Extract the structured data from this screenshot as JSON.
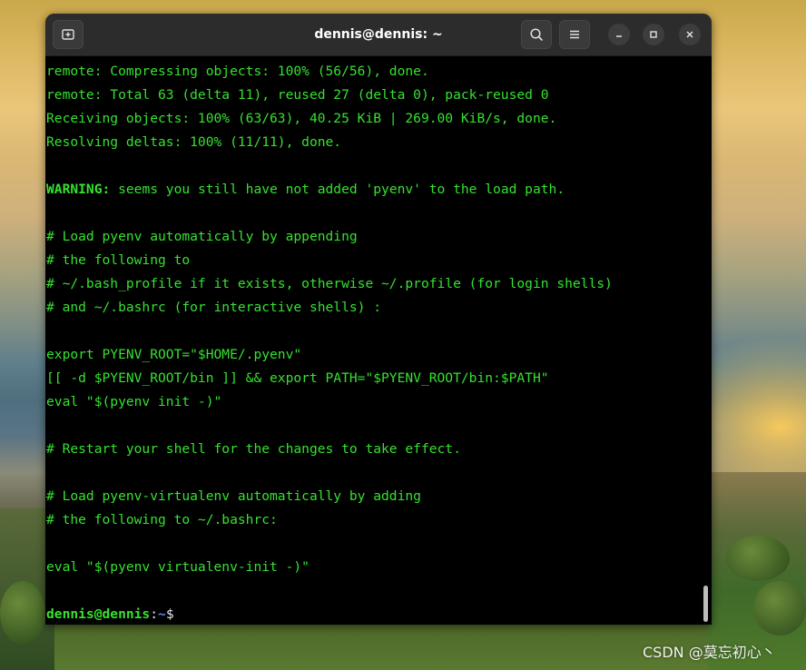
{
  "window": {
    "title": "dennis@dennis: ~",
    "new_tab_icon": "new-tab-icon",
    "search_icon": "search-icon",
    "menu_icon": "hamburger-menu-icon",
    "minimize_icon": "minimize-icon",
    "maximize_icon": "maximize-icon",
    "close_icon": "close-icon"
  },
  "terminal": {
    "lines": [
      "remote: Compressing objects: 100% (56/56), done.",
      "remote: Total 63 (delta 11), reused 27 (delta 0), pack-reused 0",
      "Receiving objects: 100% (63/63), 40.25 KiB | 269.00 KiB/s, done.",
      "Resolving deltas: 100% (11/11), done.",
      "",
      "",
      "",
      "# Load pyenv automatically by appending",
      "# the following to",
      "# ~/.bash_profile if it exists, otherwise ~/.profile (for login shells)",
      "# and ~/.bashrc (for interactive shells) :",
      "",
      "export PYENV_ROOT=\"$HOME/.pyenv\"",
      "[[ -d $PYENV_ROOT/bin ]] && export PATH=\"$PYENV_ROOT/bin:$PATH\"",
      "eval \"$(pyenv init -)\"",
      "",
      "# Restart your shell for the changes to take effect.",
      "",
      "# Load pyenv-virtualenv automatically by adding",
      "# the following to ~/.bashrc:",
      "",
      "eval \"$(pyenv virtualenv-init -)\"",
      ""
    ],
    "warning_label": "WARNING:",
    "warning_text": " seems you still have not added 'pyenv' to the load path.",
    "prompt_user": "dennis@dennis",
    "prompt_colon": ":",
    "prompt_path": "~",
    "prompt_sign": "$"
  },
  "colors": {
    "terminal_text": "#35e22f",
    "terminal_bg": "#000000",
    "titlebar_bg": "#2c2c2c",
    "prompt_path": "#4f8fe6"
  },
  "watermark": "CSDN @莫忘初心丶"
}
